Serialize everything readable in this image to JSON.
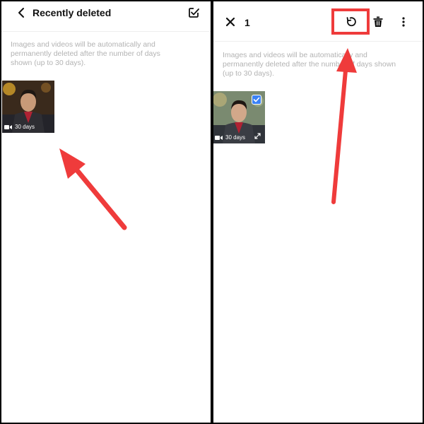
{
  "left": {
    "title": "Recently deleted",
    "info": "Images and videos will be automatically and permanently deleted after the number of days shown (up to 30 days).",
    "thumb_duration": "30 days",
    "icons": [
      "back-icon",
      "select-all-icon",
      "video-camera-icon"
    ]
  },
  "right": {
    "selected_count": "1",
    "info": "Images and videos will be automatically and permanently deleted after the number of days shown (up to 30 days).",
    "thumb_duration": "30 days",
    "icons": [
      "close-icon",
      "restore-icon",
      "delete-icon",
      "more-vert-icon",
      "checkbox-checked-icon",
      "expand-icon",
      "video-camera-icon"
    ]
  },
  "colors": {
    "annotation": "#ef3b3b",
    "accent": "#3b82f6",
    "text_muted": "#b3b3b3"
  }
}
